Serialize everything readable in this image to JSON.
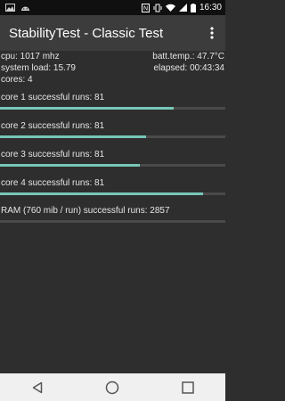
{
  "status_bar": {
    "time": "16:30",
    "left_icons": [
      "gallery-notification-icon",
      "android-notification-icon"
    ],
    "right_icons": [
      "nfc-icon",
      "vibrate-icon",
      "wifi-icon",
      "signal-icon",
      "battery-icon"
    ]
  },
  "app_bar": {
    "title": "StabilityTest - Classic Test",
    "menu_icon": "overflow-menu-icon"
  },
  "info": {
    "cpu": "cpu: 1017 mhz",
    "batt_temp": "batt.temp.: 47.7°C",
    "system_load": "system load: 15.79",
    "elapsed": "elapsed: 00:43:34",
    "cores": "cores: 4"
  },
  "cores": [
    {
      "label": "core 1 successful runs: 81",
      "progress": 0.77
    },
    {
      "label": "core 2 successful runs: 81",
      "progress": 0.65
    },
    {
      "label": "core 3 successful runs: 81",
      "progress": 0.62
    },
    {
      "label": "core 4 successful runs: 81",
      "progress": 0.9
    }
  ],
  "ram": {
    "label": "RAM (760 mib / run) successful runs: 2857",
    "progress": 0.0
  },
  "colors": {
    "accent": "#77c7b7",
    "track": "#4a4a4a",
    "background": "#2e2e2e"
  },
  "nav_bar": {
    "icons": [
      "back-icon",
      "home-icon",
      "recents-icon"
    ]
  }
}
